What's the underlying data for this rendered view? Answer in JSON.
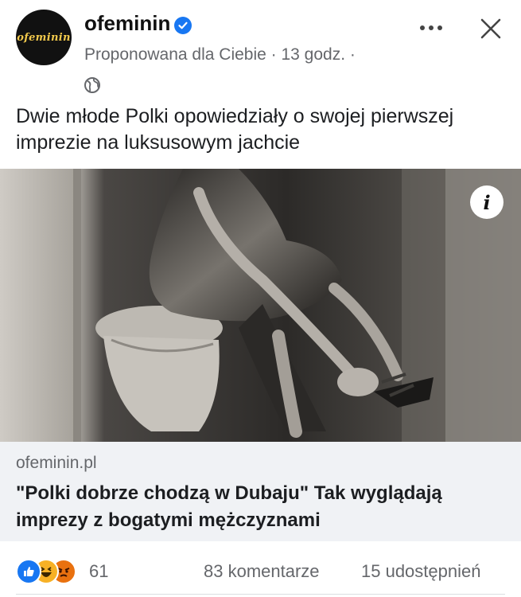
{
  "post": {
    "page_name": "ofeminin",
    "avatar_text": "ofeminin",
    "meta": "Proponowana dla Ciebie · 13 godz. ·",
    "text": "Dwie młode Polki opowiedziały o swojej pierwszej imprezie na luksusowym jachcie",
    "icons": {
      "verified": "verified-badge-icon",
      "audience": "globe-icon",
      "more": "more-options-icon",
      "close": "close-icon",
      "info": "info-icon"
    }
  },
  "photo": {
    "info_label": "i"
  },
  "link": {
    "domain": "ofeminin.pl",
    "title": "\"Polki dobrze chodzą w Dubaju\" Tak wyglądają imprezy z bogatymi mężczyznami"
  },
  "footer": {
    "reaction_count": "61",
    "reactions": [
      "like",
      "haha",
      "angry"
    ],
    "comments": "83 komentarze",
    "shares": "15 udostępnień"
  },
  "colors": {
    "accent": "#1877f2",
    "secondary_text": "#65676b",
    "link_card_bg": "#f0f2f5"
  }
}
